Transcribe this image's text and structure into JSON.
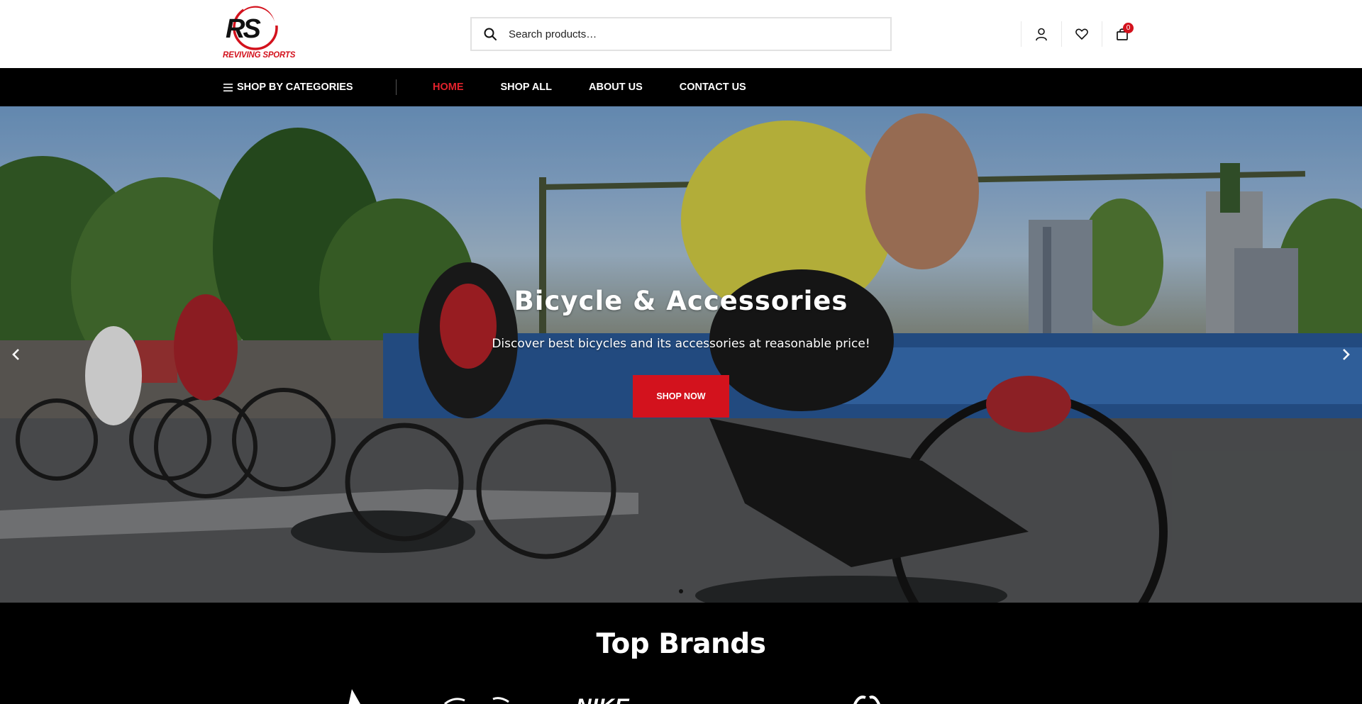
{
  "header": {
    "logo_letters": "RS",
    "logo_text": "REVIVING SPORTS",
    "search_placeholder": "Search products…",
    "cart_count": "0"
  },
  "nav": {
    "categories_label": "SHOP BY CATEGORIES",
    "links": [
      {
        "label": "HOME",
        "active": true
      },
      {
        "label": "SHOP ALL",
        "active": false
      },
      {
        "label": "ABOUT US",
        "active": false
      },
      {
        "label": "CONTACT US",
        "active": false
      }
    ]
  },
  "hero": {
    "title": "Bicycle & Accessories",
    "subtitle": "Discover best bicycles and its accessories at reasonable price!",
    "button_label": "SHOP NOW",
    "slide_count": 1,
    "active_slide": 1
  },
  "brands": {
    "title": "Top Brands",
    "logo_text_nike": "NIKE"
  },
  "colors": {
    "accent": "#d3121d",
    "nav_bg": "#000000",
    "active_link": "#e3222c"
  },
  "icons": {
    "search": "search-icon",
    "account": "user-icon",
    "wishlist": "heart-icon",
    "cart": "shopping-bag-icon",
    "categories": "menu-icon",
    "prev": "chevron-left-icon",
    "next": "chevron-right-icon"
  }
}
